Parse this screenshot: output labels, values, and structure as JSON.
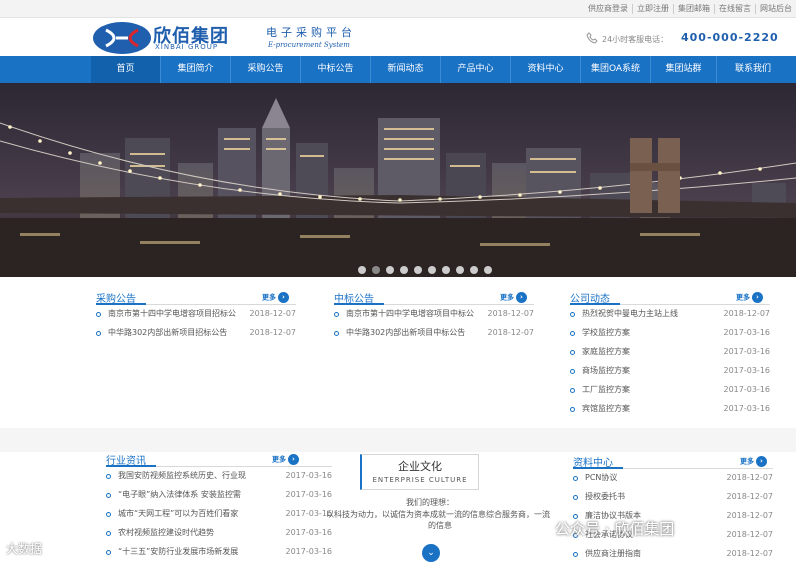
{
  "top_links": [
    "供应商登录",
    "立即注册",
    "集团邮箱",
    "在线留言",
    "网站后台"
  ],
  "logo": {
    "cn": "欣佰集团",
    "en": "XINBAI GROUP"
  },
  "platform": {
    "cn": "电子采购平台",
    "en": "E-procurement System"
  },
  "hotline": {
    "label": "24小时客服电话：",
    "number": "400-000-2220"
  },
  "nav": [
    "首页",
    "集团简介",
    "采购公告",
    "中标公告",
    "新闻动态",
    "产品中心",
    "资料中心",
    "集团OA系统",
    "集团站群",
    "联系我们"
  ],
  "more_label": "更多",
  "procurement": {
    "title": "采购公告",
    "items": [
      {
        "text": "南京市第十四中学电增容项目招标公",
        "date": "2018-12-07"
      },
      {
        "text": "中华路302内部出新项目招标公告",
        "date": "2018-12-07"
      }
    ]
  },
  "award": {
    "title": "中标公告",
    "items": [
      {
        "text": "南京市第十四中学电增容项目中标公",
        "date": "2018-12-07"
      },
      {
        "text": "中华路302内部出新项目中标公告",
        "date": "2018-12-07"
      }
    ]
  },
  "company_news": {
    "title": "公司动态",
    "items": [
      {
        "text": "热烈祝贺中曼电力主站上线",
        "date": "2018-12-07"
      },
      {
        "text": "学校监控方案",
        "date": "2017-03-16"
      },
      {
        "text": "家庭监控方案",
        "date": "2017-03-16"
      },
      {
        "text": "商场监控方案",
        "date": "2017-03-16"
      },
      {
        "text": "工厂监控方案",
        "date": "2017-03-16"
      },
      {
        "text": "宾馆监控方案",
        "date": "2017-03-16"
      }
    ]
  },
  "industry": {
    "title": "行业资讯",
    "items": [
      {
        "text": "我国安防视频监控系统历史、行业现",
        "date": "2017-03-16"
      },
      {
        "text": "“电子眼”纳入法律体系 安装监控需",
        "date": "2017-03-16"
      },
      {
        "text": "城市“天网工程”可以为百姓们看家",
        "date": "2017-03-16"
      },
      {
        "text": "农村视频监控建设时代趋势",
        "date": "2017-03-16"
      },
      {
        "text": "“十三五”安防行业发展市场新发展",
        "date": "2017-03-16"
      }
    ]
  },
  "culture": {
    "cn": "企业文化",
    "en": "ENTERPRISE CULTURE",
    "lines": [
      "我们的理想：",
      "以科技为动力，以诚信为资本成就一流的信息综合服务商，一流",
      "的信息"
    ]
  },
  "docs": {
    "title": "资料中心",
    "items": [
      {
        "text": "PCN协议",
        "date": "2018-12-07"
      },
      {
        "text": "授权委托书",
        "date": "2018-12-07"
      },
      {
        "text": "廉洁协议书版本",
        "date": "2018-12-07"
      },
      {
        "text": "社会承诺协议",
        "date": "2018-12-07"
      },
      {
        "text": "供应商注册指南",
        "date": "2018-12-07"
      }
    ]
  },
  "watermarks": {
    "left": "大数据",
    "right": "公众号 · 欣佰集团"
  },
  "colors": {
    "brand": "#1a72c5",
    "nav_active": "#1161ad"
  }
}
